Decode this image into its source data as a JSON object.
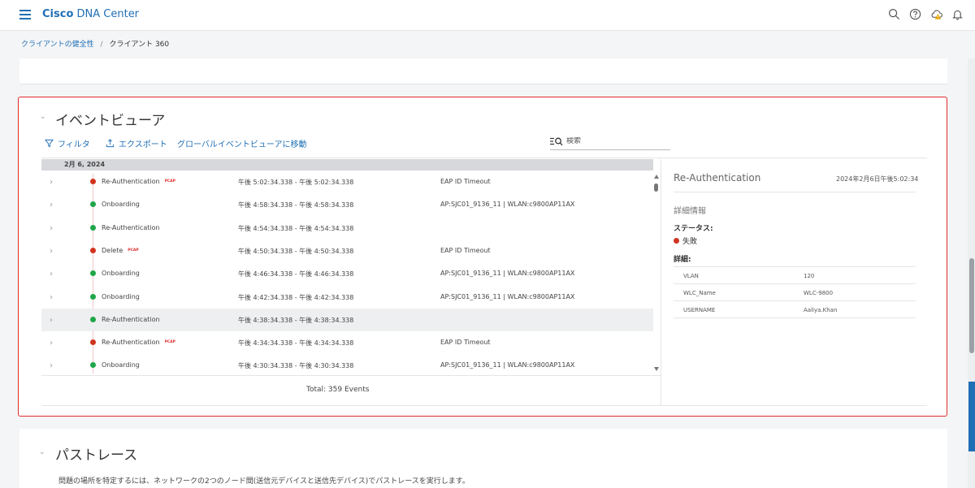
{
  "app": {
    "brand_bold": "Cisco",
    "brand_rest": "DNA Center"
  },
  "topbar_icons": [
    "search-icon",
    "help-icon",
    "cloud-alert-icon",
    "bell-icon"
  ],
  "breadcrumb": {
    "parent": "クライアントの健全性",
    "separator": "/",
    "current": "クライアント 360"
  },
  "event_viewer": {
    "title": "イベントビューア",
    "toolbar": {
      "filter": "フィルタ",
      "export": "エクスポート",
      "global": "グローバルイベントビューアに移動"
    },
    "search_placeholder": "検索",
    "date_header": "2月 6, 2024",
    "events": [
      {
        "name": "Re-Authentication",
        "pcap": "PCAP",
        "status": "fail",
        "time": "午後 5:02:34.338 - 午後 5:02:34.338",
        "detail": "EAP ID Timeout"
      },
      {
        "name": "Onboarding",
        "pcap": "",
        "status": "ok",
        "time": "午後 4:58:34.338 - 午後 4:58:34.338",
        "detail": "AP:SJC01_9136_11 | WLAN:c9800AP11AX"
      },
      {
        "name": "Re-Authentication",
        "pcap": "",
        "status": "ok",
        "time": "午後 4:54:34.338 - 午後 4:54:34.338",
        "detail": ""
      },
      {
        "name": "Delete",
        "pcap": "PCAP",
        "status": "fail",
        "time": "午後 4:50:34.338 - 午後 4:50:34.338",
        "detail": "EAP ID Timeout"
      },
      {
        "name": "Onboarding",
        "pcap": "",
        "status": "ok",
        "time": "午後 4:46:34.338 - 午後 4:46:34.338",
        "detail": "AP:SJC01_9136_11 | WLAN:c9800AP11AX"
      },
      {
        "name": "Onboarding",
        "pcap": "",
        "status": "ok",
        "time": "午後 4:42:34.338 - 午後 4:42:34.338",
        "detail": "AP:SJC01_9136_11 | WLAN:c9800AP11AX"
      },
      {
        "name": "Re-Authentication",
        "pcap": "",
        "status": "ok",
        "time": "午後 4:38:34.338 - 午後 4:38:34.338",
        "detail": "",
        "selected": true
      },
      {
        "name": "Re-Authentication",
        "pcap": "PCAP",
        "status": "fail",
        "time": "午後 4:34:34.338 - 午後 4:34:34.338",
        "detail": "EAP ID Timeout"
      },
      {
        "name": "Onboarding",
        "pcap": "",
        "status": "ok",
        "time": "午後 4:30:34.338 - 午後 4:30:34.338",
        "detail": "AP:SJC01_9136_11 | WLAN:c9800AP11AX"
      }
    ],
    "total": "Total: 359 Events",
    "detail_pane": {
      "title": "Re-Authentication",
      "timestamp": "2024年2月6日午後5:02:34",
      "section": "詳細情報",
      "status_label": "ステータス:",
      "status_value": "失敗",
      "details_label": "詳細:",
      "rows": [
        {
          "key": "VLAN",
          "value": "120"
        },
        {
          "key": "WLC_Name",
          "value": "WLC-9800"
        },
        {
          "key": "USERNAME",
          "value": "Aaliya.Khan"
        }
      ]
    },
    "colors": {
      "fail": "#d0341f",
      "ok": "#1fa64a",
      "accent": "#1f6fb6",
      "highlight_border": "#e02b2b"
    }
  },
  "path_trace": {
    "title": "パストレース",
    "description": "問題の場所を特定するには、ネットワークの2つのノード間(送信元デバイスと送信先デバイス)でパストレースを実行します。"
  }
}
